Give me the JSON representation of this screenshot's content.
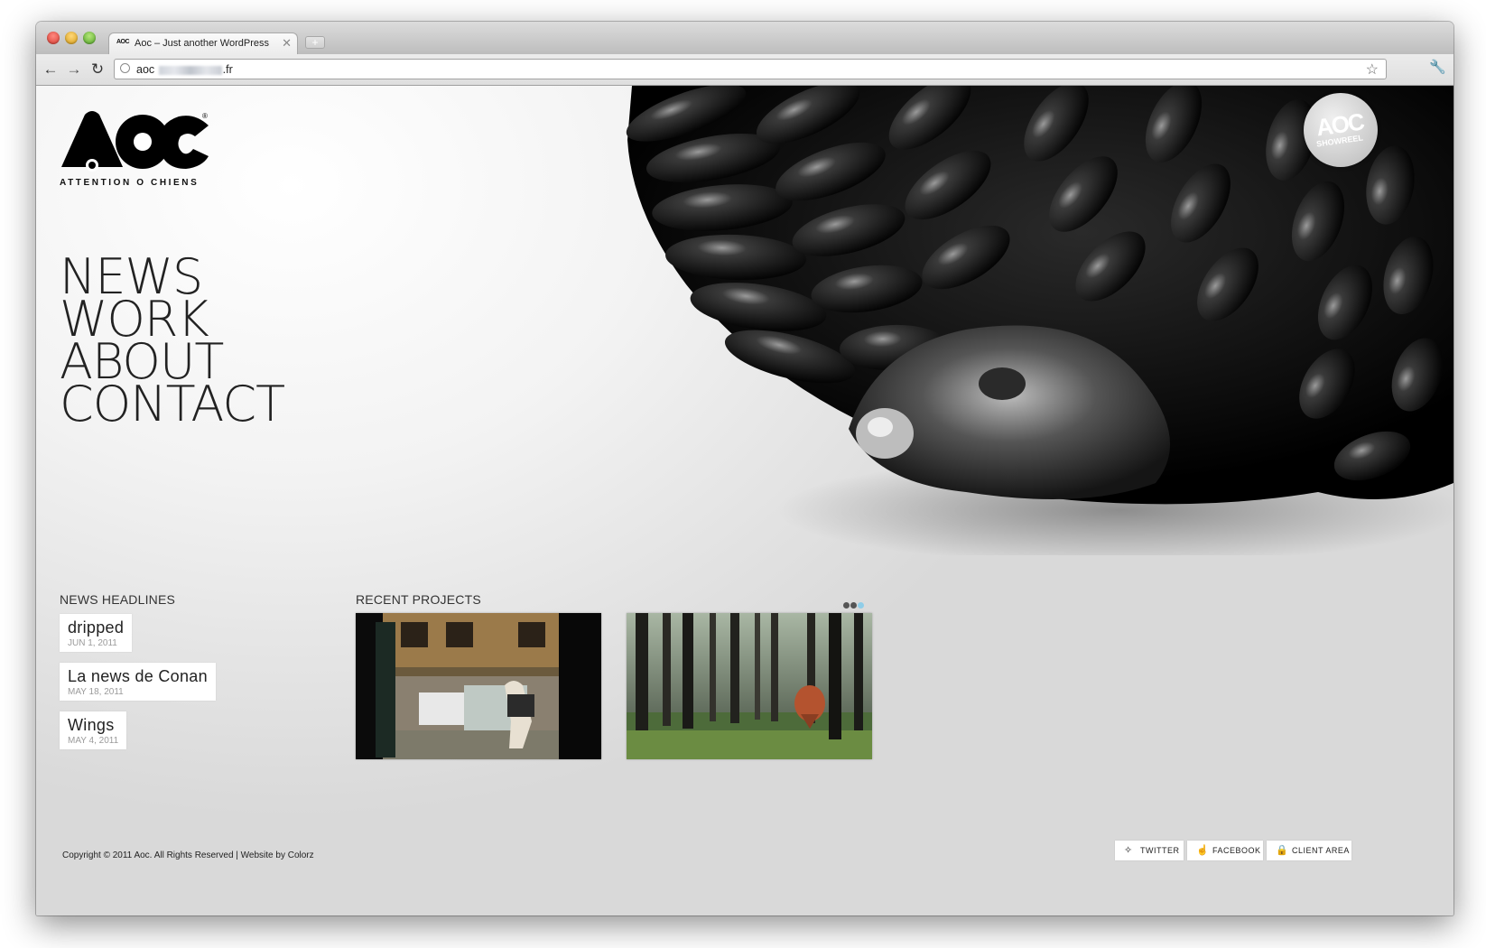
{
  "browser": {
    "tab_title": "Aoc – Just another WordPress",
    "tab_favicon": "AOC",
    "tab_close": "✕",
    "new_tab": "+",
    "url_prefix": "aoc",
    "url_suffix": ".fr",
    "icons": {
      "back": "back-arrow-icon",
      "forward": "forward-arrow-icon",
      "reload": "reload-icon",
      "bookmark": "star-icon",
      "menu": "wrench-icon"
    }
  },
  "site": {
    "logo_text": "AOC",
    "logo_subtitle": "ATTENTION O CHIENS",
    "showreel": {
      "logo": "AOC",
      "label": "SHOWREEL"
    },
    "nav": [
      "NEWS",
      "WORK",
      "ABOUT",
      "CONTACT"
    ],
    "news_heading": "NEWS HEADLINES",
    "news": [
      {
        "title": "dripped",
        "date": "JUN 1, 2011"
      },
      {
        "title": "La news de Conan",
        "date": "MAY 18, 2011"
      },
      {
        "title": "Wings",
        "date": "MAY 4, 2011"
      }
    ],
    "projects_heading": "RECENT PROJECTS",
    "carousel": {
      "pages": 3,
      "active": 3,
      "accent": "#8fcde8"
    },
    "footer_copy": "Copyright © 2011 Aoc. All Rights Reserved | Website by Colorz",
    "social": [
      {
        "label": "TWITTER",
        "icon": "twitter-bird-icon"
      },
      {
        "label": "FACEBOOK",
        "icon": "thumbs-up-icon"
      },
      {
        "label": "CLIENT AREA",
        "icon": "lock-icon"
      }
    ]
  }
}
